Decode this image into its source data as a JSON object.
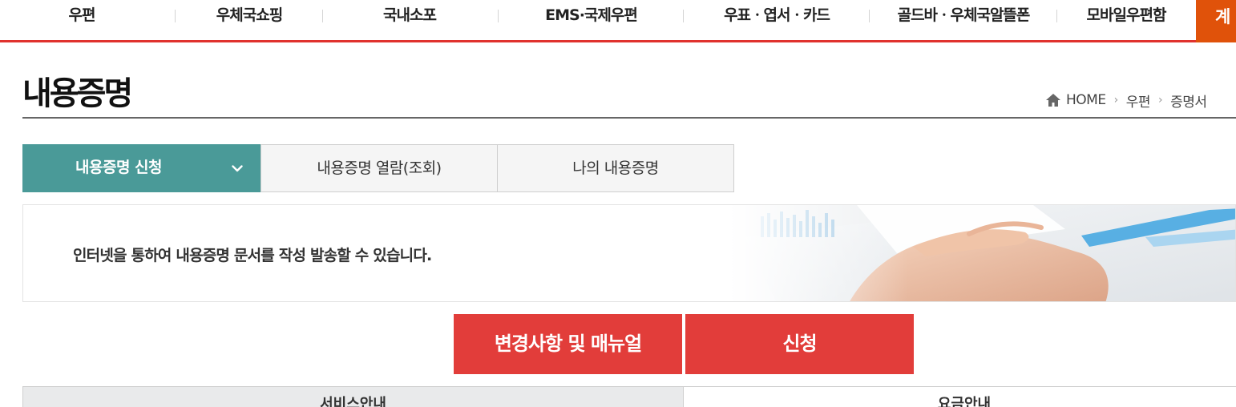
{
  "top_nav": {
    "items": [
      {
        "label": "우편"
      },
      {
        "label": "우체국쇼핑"
      },
      {
        "label": "국내소포"
      },
      {
        "label": "EMS·국제우편"
      },
      {
        "label": "우표ㆍ엽서ㆍ카드"
      },
      {
        "label": "골드바ㆍ우체국알뜰폰"
      },
      {
        "label": "모바일우편함"
      }
    ],
    "more_label": "계",
    "accent_color": "#e0322e",
    "more_color": "#e0520a"
  },
  "page": {
    "title": "내용증명"
  },
  "breadcrumb": {
    "icon": "home-icon",
    "items": [
      "HOME",
      "우편",
      "증명서"
    ]
  },
  "tabs": {
    "active": {
      "label": "내용증명 신청",
      "icon": "chevron-down-icon",
      "color": "#4a9a98"
    },
    "items": [
      {
        "label": "내용증명 열람(조회)"
      },
      {
        "label": "나의 내용증명"
      }
    ]
  },
  "banner": {
    "text": "인터넷을 통하여 내용증명 문서를 작성 발송할 수 있습니다."
  },
  "actions": {
    "manual_label": "변경사항 및 매뉴얼",
    "apply_label": "신청",
    "color": "#e23d3a"
  },
  "lower_tabs": {
    "items": [
      {
        "label": "서비스안내"
      },
      {
        "label": "요금안내"
      }
    ]
  }
}
